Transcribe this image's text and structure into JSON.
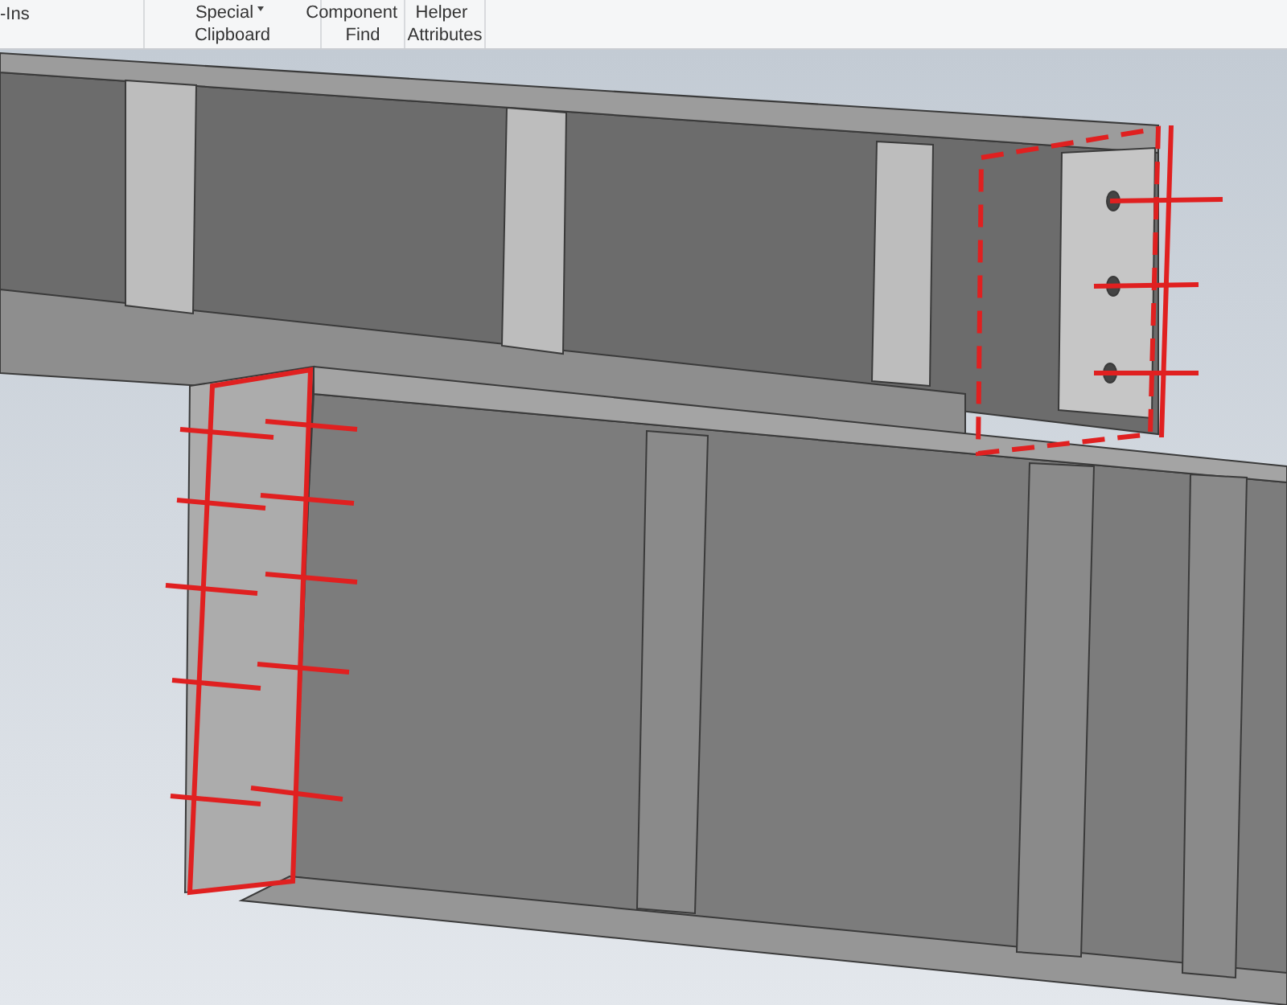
{
  "ribbon": {
    "tab_fragment": "-Ins",
    "groups": [
      {
        "label": "Clipboard",
        "buttons": [
          {
            "label": "Special",
            "has_menu": true
          }
        ]
      },
      {
        "label": "Find",
        "buttons": [
          {
            "label": "Component",
            "has_menu": false
          }
        ]
      },
      {
        "label": "Attributes",
        "buttons": [
          {
            "label": "Helper",
            "has_menu": false
          }
        ]
      }
    ]
  }
}
